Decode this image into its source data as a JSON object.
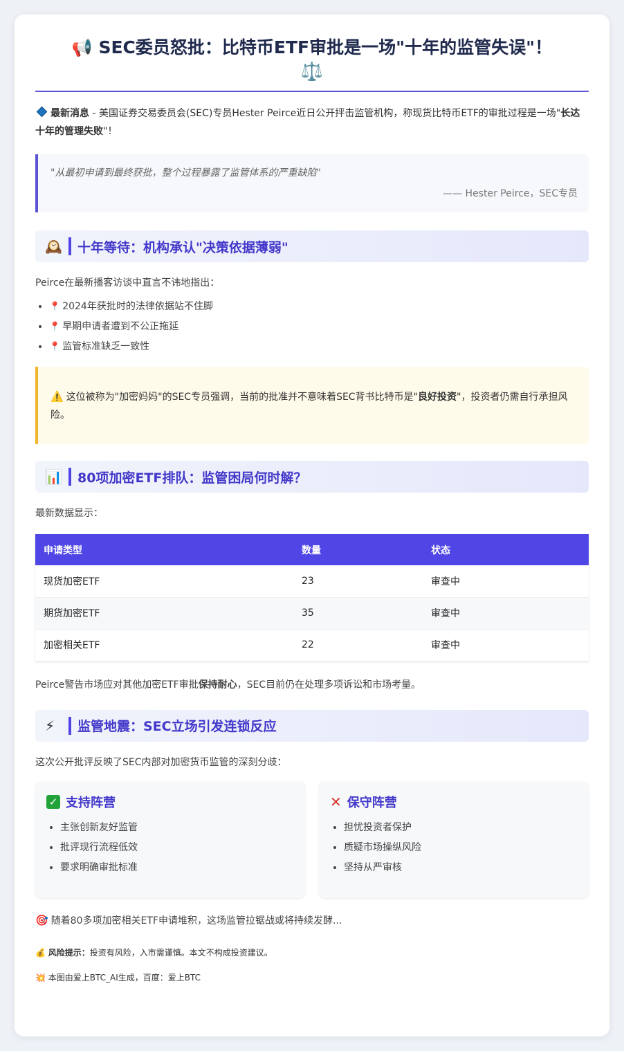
{
  "header": {
    "megaphone_icon": "megaphone-icon",
    "title": "SEC委员怒批：比特币ETF审批是一场\"十年的监管失误\"！",
    "scale_icon": "balance-scale-icon"
  },
  "lead": {
    "label": "最新消息",
    "text": " - 美国证券交易委员会(SEC)专员Hester Peirce近日公开抨击监管机构，称现货比特币ETF的审批过程是一场\"",
    "bold": "长达十年的管理失败",
    "end": "\"！"
  },
  "quote": {
    "text": "\"从最初申请到最终获批，整个过程暴露了监管体系的严重缺陷\"",
    "author": "—— Hester Peirce，SEC专员"
  },
  "section1": {
    "icon": "mantel-clock-icon",
    "title": "十年等待：机构承认\"决策依据薄弱\"",
    "intro": "Peirce在最新播客访谈中直言不讳地指出：",
    "points": [
      "2024年获批时的法律依据站不住脚",
      "早期申请者遭到不公正拖延",
      "监管标准缺乏一致性"
    ],
    "warning_pre": "这位被称为\"加密妈妈\"的SEC专员强调，当前的批准并不意味着SEC背书比特币是\"",
    "warning_bold": "良好投资",
    "warning_post": "\"，投资者仍需自行承担风险。"
  },
  "section2": {
    "icon": "bar-chart-icon",
    "title": "80项加密ETF排队：监管困局何时解？",
    "intro": "最新数据显示：",
    "table": {
      "headers": [
        "申请类型",
        "数量",
        "状态"
      ],
      "rows": [
        [
          "现货加密ETF",
          "23",
          "审查中"
        ],
        [
          "期货加密ETF",
          "35",
          "审查中"
        ],
        [
          "加密相关ETF",
          "22",
          "审查中"
        ]
      ]
    },
    "outro_pre": "Peirce警告市场应对其他加密ETF审批",
    "outro_bold": "保持耐心",
    "outro_post": "，SEC目前仍在处理多项诉讼和市场考量。"
  },
  "section3": {
    "icon": "lightning-icon",
    "title": "监管地震：SEC立场引发连锁反应",
    "intro": "这次公开批评反映了SEC内部对加密货币监管的深刻分歧：",
    "camps": [
      {
        "title": "支持阵营",
        "items": [
          "主张创新友好监管",
          "批评现行流程低效",
          "要求明确审批标准"
        ]
      },
      {
        "title": "保守阵营",
        "items": [
          "担忧投资者保护",
          "质疑市场操纵风险",
          "坚持从严审核"
        ]
      }
    ]
  },
  "closing": "随着80多项加密相关ETF申请堆积，这场监管拉锯战或将持续发酵...",
  "risk": {
    "label": "风险提示：",
    "text": "投资有风险，入市需谨慎。本文不构成投资建议。"
  },
  "credit": "本图由爱上BTC_AI生成，百度：爱上BTC"
}
